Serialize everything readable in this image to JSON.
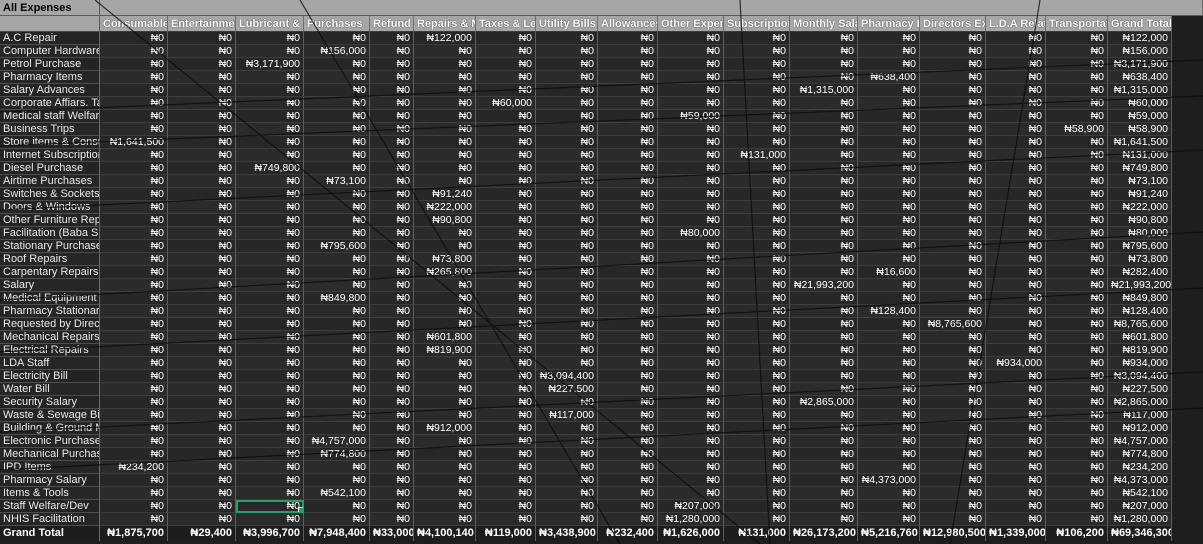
{
  "title": "All Expenses",
  "row_header_label": "",
  "columns": [
    "Consumables",
    "Entertainment",
    "Lubricant & Fuel",
    "Purchases",
    "Refund",
    "Repairs & M",
    "Taxes & Levi",
    "Utility Bills",
    "Allowances",
    "Other Expen",
    "Subscriptions",
    "Monthly Salary",
    "Pharmacy Re",
    "Directors Expens",
    "L.D.A Relate",
    "Transportati",
    "Grand Total"
  ],
  "zero": "₦0",
  "rows": [
    {
      "label": "A.C Repair",
      "values": [
        "₦0",
        "₦0",
        "₦0",
        "₦0",
        "₦0",
        "₦122,000",
        "₦0",
        "₦0",
        "₦0",
        "₦0",
        "₦0",
        "₦0",
        "₦0",
        "₦0",
        "₦0",
        "₦0",
        "₦122,000"
      ]
    },
    {
      "label": "Computer Hardwares",
      "values": [
        "₦0",
        "₦0",
        "₦0",
        "₦156,000",
        "₦0",
        "₦0",
        "₦0",
        "₦0",
        "₦0",
        "₦0",
        "₦0",
        "₦0",
        "₦0",
        "₦0",
        "₦0",
        "₦0",
        "₦156,000"
      ]
    },
    {
      "label": "Petrol Purchase",
      "values": [
        "₦0",
        "₦0",
        "₦3,171,900",
        "₦0",
        "₦0",
        "₦0",
        "₦0",
        "₦0",
        "₦0",
        "₦0",
        "₦0",
        "₦0",
        "₦0",
        "₦0",
        "₦0",
        "₦0",
        "₦3,171,900"
      ]
    },
    {
      "label": "Pharmacy Items",
      "values": [
        "₦0",
        "₦0",
        "₦0",
        "₦0",
        "₦0",
        "₦0",
        "₦0",
        "₦0",
        "₦0",
        "₦0",
        "₦0",
        "₦0",
        "₦638,400",
        "₦0",
        "₦0",
        "₦0",
        "₦638,400"
      ]
    },
    {
      "label": "Salary Advances",
      "values": [
        "₦0",
        "₦0",
        "₦0",
        "₦0",
        "₦0",
        "₦0",
        "₦0",
        "₦0",
        "₦0",
        "₦0",
        "₦0",
        "₦1,315,000",
        "₦0",
        "₦0",
        "₦0",
        "₦0",
        "₦1,315,000"
      ]
    },
    {
      "label": "Corporate Affiars. Tax",
      "values": [
        "₦0",
        "₦0",
        "₦0",
        "₦0",
        "₦0",
        "₦0",
        "₦60,000",
        "₦0",
        "₦0",
        "₦0",
        "₦0",
        "₦0",
        "₦0",
        "₦0",
        "₦0",
        "₦0",
        "₦60,000"
      ]
    },
    {
      "label": "Medical staff Welfare",
      "values": [
        "₦0",
        "₦0",
        "₦0",
        "₦0",
        "₦0",
        "₦0",
        "₦0",
        "₦0",
        "₦0",
        "₦59,000",
        "₦0",
        "₦0",
        "₦0",
        "₦0",
        "₦0",
        "₦0",
        "₦59,000"
      ]
    },
    {
      "label": "Business Trips",
      "values": [
        "₦0",
        "₦0",
        "₦0",
        "₦0",
        "₦0",
        "₦0",
        "₦0",
        "₦0",
        "₦0",
        "₦0",
        "₦0",
        "₦0",
        "₦0",
        "₦0",
        "₦0",
        "₦58,900",
        "₦58,900"
      ]
    },
    {
      "label": "Store items & Consum.",
      "values": [
        "₦1,641,500",
        "₦0",
        "₦0",
        "₦0",
        "₦0",
        "₦0",
        "₦0",
        "₦0",
        "₦0",
        "₦0",
        "₦0",
        "₦0",
        "₦0",
        "₦0",
        "₦0",
        "₦0",
        "₦1,641,500"
      ]
    },
    {
      "label": "Internet Subscription",
      "values": [
        "₦0",
        "₦0",
        "₦0",
        "₦0",
        "₦0",
        "₦0",
        "₦0",
        "₦0",
        "₦0",
        "₦0",
        "₦131,000",
        "₦0",
        "₦0",
        "₦0",
        "₦0",
        "₦0",
        "₦131,000"
      ]
    },
    {
      "label": "Diesel Purchase",
      "values": [
        "₦0",
        "₦0",
        "₦749,800",
        "₦0",
        "₦0",
        "₦0",
        "₦0",
        "₦0",
        "₦0",
        "₦0",
        "₦0",
        "₦0",
        "₦0",
        "₦0",
        "₦0",
        "₦0",
        "₦749,800"
      ]
    },
    {
      "label": "Airtime Purchases",
      "values": [
        "₦0",
        "₦0",
        "₦0",
        "₦73,100",
        "₦0",
        "₦0",
        "₦0",
        "₦0",
        "₦0",
        "₦0",
        "₦0",
        "₦0",
        "₦0",
        "₦0",
        "₦0",
        "₦0",
        "₦73,100"
      ]
    },
    {
      "label": "Switches & Sockets",
      "values": [
        "₦0",
        "₦0",
        "₦0",
        "₦0",
        "₦0",
        "₦91,240",
        "₦0",
        "₦0",
        "₦0",
        "₦0",
        "₦0",
        "₦0",
        "₦0",
        "₦0",
        "₦0",
        "₦0",
        "₦91,240"
      ]
    },
    {
      "label": "Doors & Windows",
      "values": [
        "₦0",
        "₦0",
        "₦0",
        "₦0",
        "₦0",
        "₦222,000",
        "₦0",
        "₦0",
        "₦0",
        "₦0",
        "₦0",
        "₦0",
        "₦0",
        "₦0",
        "₦0",
        "₦0",
        "₦222,000"
      ]
    },
    {
      "label": "Other Furniture Replace",
      "values": [
        "₦0",
        "₦0",
        "₦0",
        "₦0",
        "₦0",
        "₦90,800",
        "₦0",
        "₦0",
        "₦0",
        "₦0",
        "₦0",
        "₦0",
        "₦0",
        "₦0",
        "₦0",
        "₦0",
        "₦90,800"
      ]
    },
    {
      "label": "Facilitation (Baba Saidu",
      "values": [
        "₦0",
        "₦0",
        "₦0",
        "₦0",
        "₦0",
        "₦0",
        "₦0",
        "₦0",
        "₦0",
        "₦80,000",
        "₦0",
        "₦0",
        "₦0",
        "₦0",
        "₦0",
        "₦0",
        "₦80,000"
      ]
    },
    {
      "label": "Stationary Purchases",
      "values": [
        "₦0",
        "₦0",
        "₦0",
        "₦795,600",
        "₦0",
        "₦0",
        "₦0",
        "₦0",
        "₦0",
        "₦0",
        "₦0",
        "₦0",
        "₦0",
        "₦0",
        "₦0",
        "₦0",
        "₦795,600"
      ]
    },
    {
      "label": "Roof Repairs",
      "values": [
        "₦0",
        "₦0",
        "₦0",
        "₦0",
        "₦0",
        "₦73,800",
        "₦0",
        "₦0",
        "₦0",
        "₦0",
        "₦0",
        "₦0",
        "₦0",
        "₦0",
        "₦0",
        "₦0",
        "₦73,800"
      ]
    },
    {
      "label": "Carpentary Repairs",
      "values": [
        "₦0",
        "₦0",
        "₦0",
        "₦0",
        "₦0",
        "₦265,800",
        "₦0",
        "₦0",
        "₦0",
        "₦0",
        "₦0",
        "₦0",
        "₦16,600",
        "₦0",
        "₦0",
        "₦0",
        "₦282,400"
      ]
    },
    {
      "label": "Salary",
      "values": [
        "₦0",
        "₦0",
        "₦0",
        "₦0",
        "₦0",
        "₦0",
        "₦0",
        "₦0",
        "₦0",
        "₦0",
        "₦0",
        "₦21,993,200",
        "₦0",
        "₦0",
        "₦0",
        "₦0",
        "₦21,993,200"
      ]
    },
    {
      "label": "Medical Equipment Pur",
      "values": [
        "₦0",
        "₦0",
        "₦0",
        "₦849,800",
        "₦0",
        "₦0",
        "₦0",
        "₦0",
        "₦0",
        "₦0",
        "₦0",
        "₦0",
        "₦0",
        "₦0",
        "₦0",
        "₦0",
        "₦849,800"
      ]
    },
    {
      "label": "Pharmacy Stationary's",
      "values": [
        "₦0",
        "₦0",
        "₦0",
        "₦0",
        "₦0",
        "₦0",
        "₦0",
        "₦0",
        "₦0",
        "₦0",
        "₦0",
        "₦0",
        "₦128,400",
        "₦0",
        "₦0",
        "₦0",
        "₦128,400"
      ]
    },
    {
      "label": "Requested by Director",
      "values": [
        "₦0",
        "₦0",
        "₦0",
        "₦0",
        "₦0",
        "₦0",
        "₦0",
        "₦0",
        "₦0",
        "₦0",
        "₦0",
        "₦0",
        "₦0",
        "₦8,765,600",
        "₦0",
        "₦0",
        "₦8,765,600"
      ]
    },
    {
      "label": "Mechanical Repairs",
      "values": [
        "₦0",
        "₦0",
        "₦0",
        "₦0",
        "₦0",
        "₦601,800",
        "₦0",
        "₦0",
        "₦0",
        "₦0",
        "₦0",
        "₦0",
        "₦0",
        "₦0",
        "₦0",
        "₦0",
        "₦601,800"
      ]
    },
    {
      "label": "Electrical Repairs",
      "values": [
        "₦0",
        "₦0",
        "₦0",
        "₦0",
        "₦0",
        "₦819,900",
        "₦0",
        "₦0",
        "₦0",
        "₦0",
        "₦0",
        "₦0",
        "₦0",
        "₦0",
        "₦0",
        "₦0",
        "₦819,900"
      ]
    },
    {
      "label": "LDA Staff",
      "values": [
        "₦0",
        "₦0",
        "₦0",
        "₦0",
        "₦0",
        "₦0",
        "₦0",
        "₦0",
        "₦0",
        "₦0",
        "₦0",
        "₦0",
        "₦0",
        "₦0",
        "₦934,000",
        "₦0",
        "₦934,000"
      ]
    },
    {
      "label": "Electricity Bill",
      "values": [
        "₦0",
        "₦0",
        "₦0",
        "₦0",
        "₦0",
        "₦0",
        "₦0",
        "₦3,094,400",
        "₦0",
        "₦0",
        "₦0",
        "₦0",
        "₦0",
        "₦0",
        "₦0",
        "₦0",
        "₦3,094,400"
      ]
    },
    {
      "label": "Water Bill",
      "values": [
        "₦0",
        "₦0",
        "₦0",
        "₦0",
        "₦0",
        "₦0",
        "₦0",
        "₦227,500",
        "₦0",
        "₦0",
        "₦0",
        "₦0",
        "₦0",
        "₦0",
        "₦0",
        "₦0",
        "₦227,500"
      ]
    },
    {
      "label": "Security Salary",
      "values": [
        "₦0",
        "₦0",
        "₦0",
        "₦0",
        "₦0",
        "₦0",
        "₦0",
        "₦0",
        "₦0",
        "₦0",
        "₦0",
        "₦2,865,000",
        "₦0",
        "₦0",
        "₦0",
        "₦0",
        "₦2,865,000"
      ]
    },
    {
      "label": "Waste & Sewage Bill",
      "values": [
        "₦0",
        "₦0",
        "₦0",
        "₦0",
        "₦0",
        "₦0",
        "₦0",
        "₦117,000",
        "₦0",
        "₦0",
        "₦0",
        "₦0",
        "₦0",
        "₦0",
        "₦0",
        "₦0",
        "₦117,000"
      ]
    },
    {
      "label": "Building & Ground Mair",
      "values": [
        "₦0",
        "₦0",
        "₦0",
        "₦0",
        "₦0",
        "₦912,000",
        "₦0",
        "₦0",
        "₦0",
        "₦0",
        "₦0",
        "₦0",
        "₦0",
        "₦0",
        "₦0",
        "₦0",
        "₦912,000"
      ]
    },
    {
      "label": "Electronic Purchase",
      "values": [
        "₦0",
        "₦0",
        "₦0",
        "₦4,757,000",
        "₦0",
        "₦0",
        "₦0",
        "₦0",
        "₦0",
        "₦0",
        "₦0",
        "₦0",
        "₦0",
        "₦0",
        "₦0",
        "₦0",
        "₦4,757,000"
      ]
    },
    {
      "label": "Mechanical Purchases",
      "values": [
        "₦0",
        "₦0",
        "₦0",
        "₦774,800",
        "₦0",
        "₦0",
        "₦0",
        "₦0",
        "₦0",
        "₦0",
        "₦0",
        "₦0",
        "₦0",
        "₦0",
        "₦0",
        "₦0",
        "₦774,800"
      ]
    },
    {
      "label": "IPD Items",
      "values": [
        "₦234,200",
        "₦0",
        "₦0",
        "₦0",
        "₦0",
        "₦0",
        "₦0",
        "₦0",
        "₦0",
        "₦0",
        "₦0",
        "₦0",
        "₦0",
        "₦0",
        "₦0",
        "₦0",
        "₦234,200"
      ]
    },
    {
      "label": "Pharmacy Salary",
      "values": [
        "₦0",
        "₦0",
        "₦0",
        "₦0",
        "₦0",
        "₦0",
        "₦0",
        "₦0",
        "₦0",
        "₦0",
        "₦0",
        "₦0",
        "₦4,373,000",
        "₦0",
        "₦0",
        "₦0",
        "₦4,373,000"
      ]
    },
    {
      "label": "Items & Tools",
      "values": [
        "₦0",
        "₦0",
        "₦0",
        "₦542,100",
        "₦0",
        "₦0",
        "₦0",
        "₦0",
        "₦0",
        "₦0",
        "₦0",
        "₦0",
        "₦0",
        "₦0",
        "₦0",
        "₦0",
        "₦542,100"
      ]
    },
    {
      "label": "Staff Welfare/Dev",
      "values": [
        "₦0",
        "₦0",
        "₦0",
        "₦0",
        "₦0",
        "₦0",
        "₦0",
        "₦0",
        "₦0",
        "₦207,000",
        "₦0",
        "₦0",
        "₦0",
        "₦0",
        "₦0",
        "₦0",
        "₦207,000"
      ]
    },
    {
      "label": "NHIS Facilitation",
      "values": [
        "₦0",
        "₦0",
        "₦0",
        "₦0",
        "₦0",
        "₦0",
        "₦0",
        "₦0",
        "₦0",
        "₦1,280,000",
        "₦0",
        "₦0",
        "₦0",
        "₦0",
        "₦0",
        "₦0",
        "₦1,280,000"
      ]
    }
  ],
  "total_row": {
    "label": "Grand Total",
    "values": [
      "₦1,875,700",
      "₦29,400",
      "₦3,996,700",
      "₦7,948,400",
      "₦33,000",
      "₦4,100,140",
      "₦119,000",
      "₦3,438,900",
      "₦232,400",
      "₦1,626,000",
      "₦131,000",
      "₦26,173,200",
      "₦5,216,760",
      "₦12,980,500",
      "₦1,339,000",
      "₦106,200",
      "₦69,346,300"
    ]
  },
  "selection": {
    "row_index": 36,
    "col_index": 2
  },
  "colors": {
    "selection": "#21a366",
    "header_bg": "#a6a6a6",
    "body_bg": "#2b2b2b"
  }
}
